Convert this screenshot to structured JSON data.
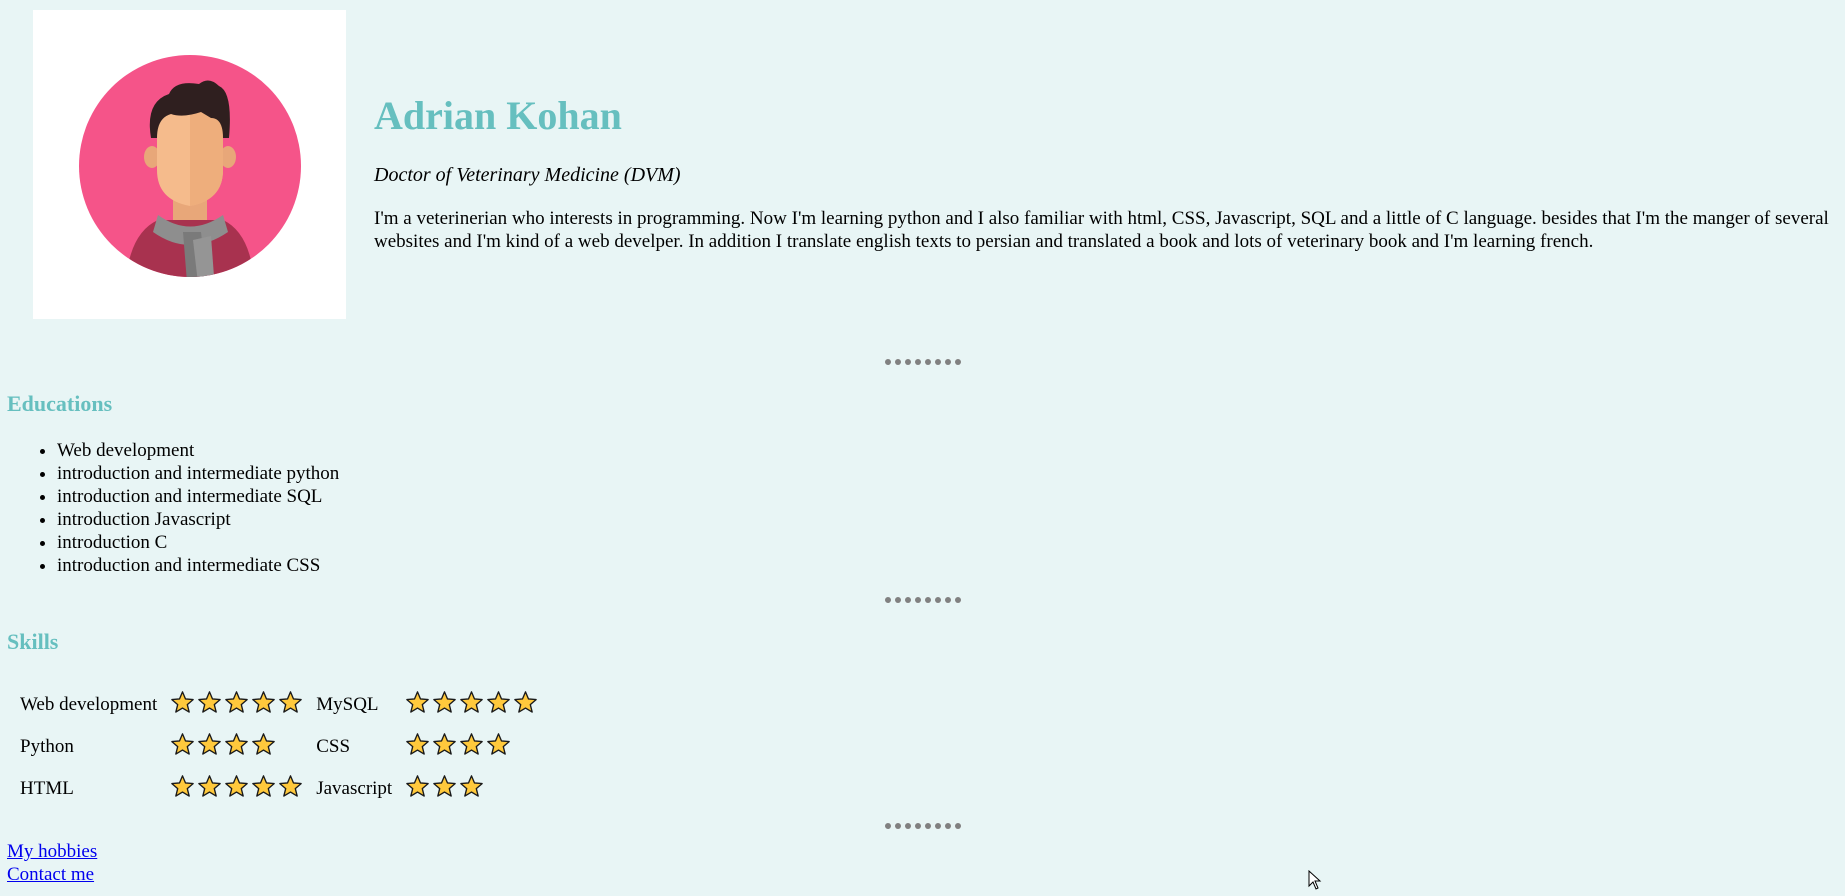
{
  "profile": {
    "name": "Adrian Kohan",
    "title": "Doctor of Veterinary Medicine (DVM)",
    "bio": "I'm a veterinerian who interests in programming. Now I'm learning python and I also familiar with html, CSS, Javascript, SQL and a little of C language. besides that I'm the manger of several websites and I'm kind of a web develper. In addition I translate english texts to persian and translated a book and lots of veterinary book and I'm learning french.",
    "avatar_icon": "man-with-scarf-avatar"
  },
  "educations": {
    "heading": "Educations",
    "items": [
      "Web development",
      "introduction and intermediate python",
      "introduction and intermediate SQL",
      "introduction Javascript",
      "introduction C",
      "introduction and intermediate CSS"
    ]
  },
  "skills": {
    "heading": "Skills",
    "rows": [
      {
        "left": {
          "name": "Web development",
          "stars": 5
        },
        "right": {
          "name": "MySQL",
          "stars": 5
        }
      },
      {
        "left": {
          "name": "Python",
          "stars": 4
        },
        "right": {
          "name": "CSS",
          "stars": 4
        }
      },
      {
        "left": {
          "name": "HTML",
          "stars": 5
        },
        "right": {
          "name": "Javascript",
          "stars": 3
        }
      }
    ]
  },
  "links": {
    "hobbies": "My hobbies",
    "contact": "Contact me"
  },
  "colors": {
    "background": "#e8f5f5",
    "accent": "#66bfbf",
    "star_fill": "#ffc93c",
    "avatar_circle": "#f55489",
    "link": "#0000ee"
  }
}
